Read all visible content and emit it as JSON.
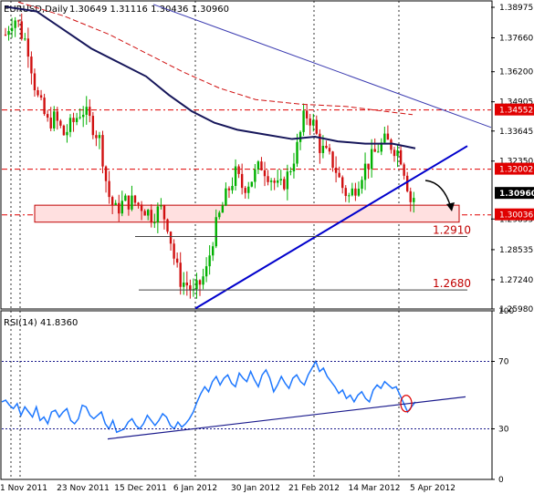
{
  "chart_data": [
    {
      "type": "candlestick",
      "symbol_header": "EURUSD,Daily",
      "ohlc_header": "1.30649 1.31116 1.30436 1.30960",
      "ylim": [
        1.2598,
        1.3925
      ],
      "y_ticks": [
        "1.38975",
        "1.37660",
        "1.36200",
        "1.34905",
        "1.33645",
        "1.32350",
        "1.30960",
        "1.29855",
        "1.28535",
        "1.27240",
        "1.25980"
      ],
      "last_price": "1.30960",
      "last_price_num": 1.3096,
      "level_tags": [
        {
          "label": "1.34552",
          "value": 1.34552
        },
        {
          "label": "1.32002",
          "value": 1.32002
        },
        {
          "label": "1.30036",
          "value": 1.30036
        }
      ],
      "annotations": [
        {
          "label": "1.2910",
          "value": 1.291
        },
        {
          "label": "1.2680",
          "value": 1.268
        }
      ],
      "ma_slow_start": 1.3895,
      "ma_slow_end": 1.3455,
      "trend_upper": [
        1.391,
        1.338
      ],
      "colors": {
        "up": "#00b000",
        "down": "#d01010",
        "ma_fast": "#16165a",
        "ma_slow": "#d01010",
        "trend": "#0000cc",
        "level_box": "#ffe0e0",
        "tag_bg": "#e00000"
      }
    },
    {
      "type": "line",
      "title": "RSI(14) 41.8360",
      "ylim": [
        0,
        100
      ],
      "y_ticks": [
        "100",
        "70",
        "30",
        "0"
      ],
      "levels": [
        70,
        30
      ],
      "series": [
        {
          "values": [
            46,
            47,
            44,
            42,
            45,
            38,
            43,
            40,
            37,
            43,
            35,
            37,
            33,
            40,
            41,
            37,
            40,
            42,
            35,
            33,
            36,
            44,
            43,
            38,
            36,
            38,
            40,
            33,
            30,
            35,
            28,
            29,
            30,
            34,
            36,
            32,
            30,
            33,
            38,
            35,
            32,
            35,
            39,
            37,
            32,
            30,
            34,
            31,
            33,
            36,
            40,
            46,
            51,
            55,
            52,
            58,
            61,
            56,
            60,
            62,
            57,
            55,
            63,
            60,
            58,
            64,
            59,
            55,
            62,
            65,
            60,
            52,
            56,
            61,
            57,
            54,
            60,
            62,
            58,
            56,
            62,
            66,
            70,
            64,
            66,
            61,
            58,
            55,
            51,
            53,
            48,
            50,
            46,
            50,
            52,
            48,
            46,
            53,
            56,
            54,
            58,
            56,
            54,
            55,
            50,
            45,
            40,
            43,
            46
          ],
          "color": "#1e78ff"
        }
      ]
    }
  ],
  "x_labels": [
    "1 Nov 2011",
    "23 Nov 2011",
    "15 Dec 2011",
    "6 Jan 2012",
    "30 Jan 2012",
    "21 Feb 2012",
    "14 Mar 2012",
    "5 Apr 2012"
  ]
}
